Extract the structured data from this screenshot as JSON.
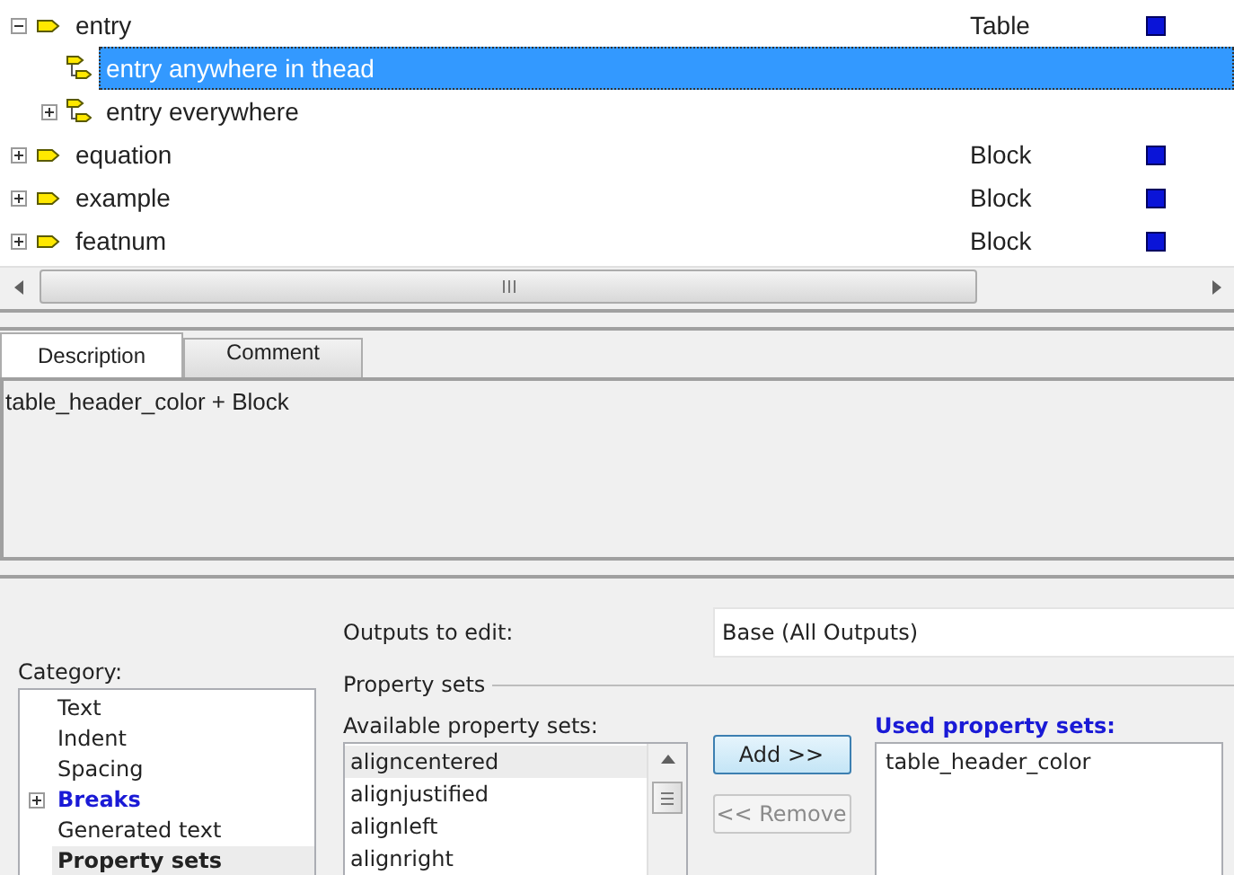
{
  "tree": [
    {
      "label": "entry",
      "type": "Table",
      "expanded": true,
      "selected": false,
      "children": [
        {
          "label": "entry anywhere in thead",
          "selected": true
        },
        {
          "label": "entry everywhere",
          "expanded": false,
          "selected": false
        }
      ]
    },
    {
      "label": "equation",
      "type": "Block",
      "expanded": false,
      "selected": false
    },
    {
      "label": "example",
      "type": "Block",
      "expanded": false,
      "selected": false
    },
    {
      "label": "featnum",
      "type": "Block",
      "expanded": false,
      "selected": false
    }
  ],
  "tabs": [
    {
      "label": "Description",
      "selected": true
    },
    {
      "label": "Comment",
      "selected": false
    }
  ],
  "description": "table_header_color + Block",
  "outputs": {
    "label": "Outputs to edit:",
    "value": "Base (All Outputs)"
  },
  "category": {
    "label": "Category:",
    "items": [
      {
        "label": "Text",
        "modified": false,
        "selected": false
      },
      {
        "label": "Indent",
        "modified": false,
        "selected": false
      },
      {
        "label": "Spacing",
        "modified": false,
        "selected": false
      },
      {
        "label": "Breaks",
        "modified": true,
        "expanded": false,
        "selected": false
      },
      {
        "label": "Generated text",
        "modified": false,
        "selected": false
      },
      {
        "label": "Property sets",
        "modified": false,
        "selected": true
      }
    ]
  },
  "property_sets": {
    "title": "Property sets",
    "available": {
      "label": "Available property sets:",
      "items": [
        {
          "label": "aligncentered",
          "selected": true
        },
        {
          "label": "alignjustified",
          "selected": false
        },
        {
          "label": "alignleft",
          "selected": false
        },
        {
          "label": "alignright",
          "selected": false
        }
      ]
    },
    "buttons": [
      {
        "label": "Add >>",
        "disabled": false
      },
      {
        "label": "<< Remove",
        "disabled": true
      }
    ],
    "used": {
      "label": "Used property sets:",
      "items": [
        {
          "label": "table_header_color",
          "selected": false
        }
      ]
    }
  }
}
